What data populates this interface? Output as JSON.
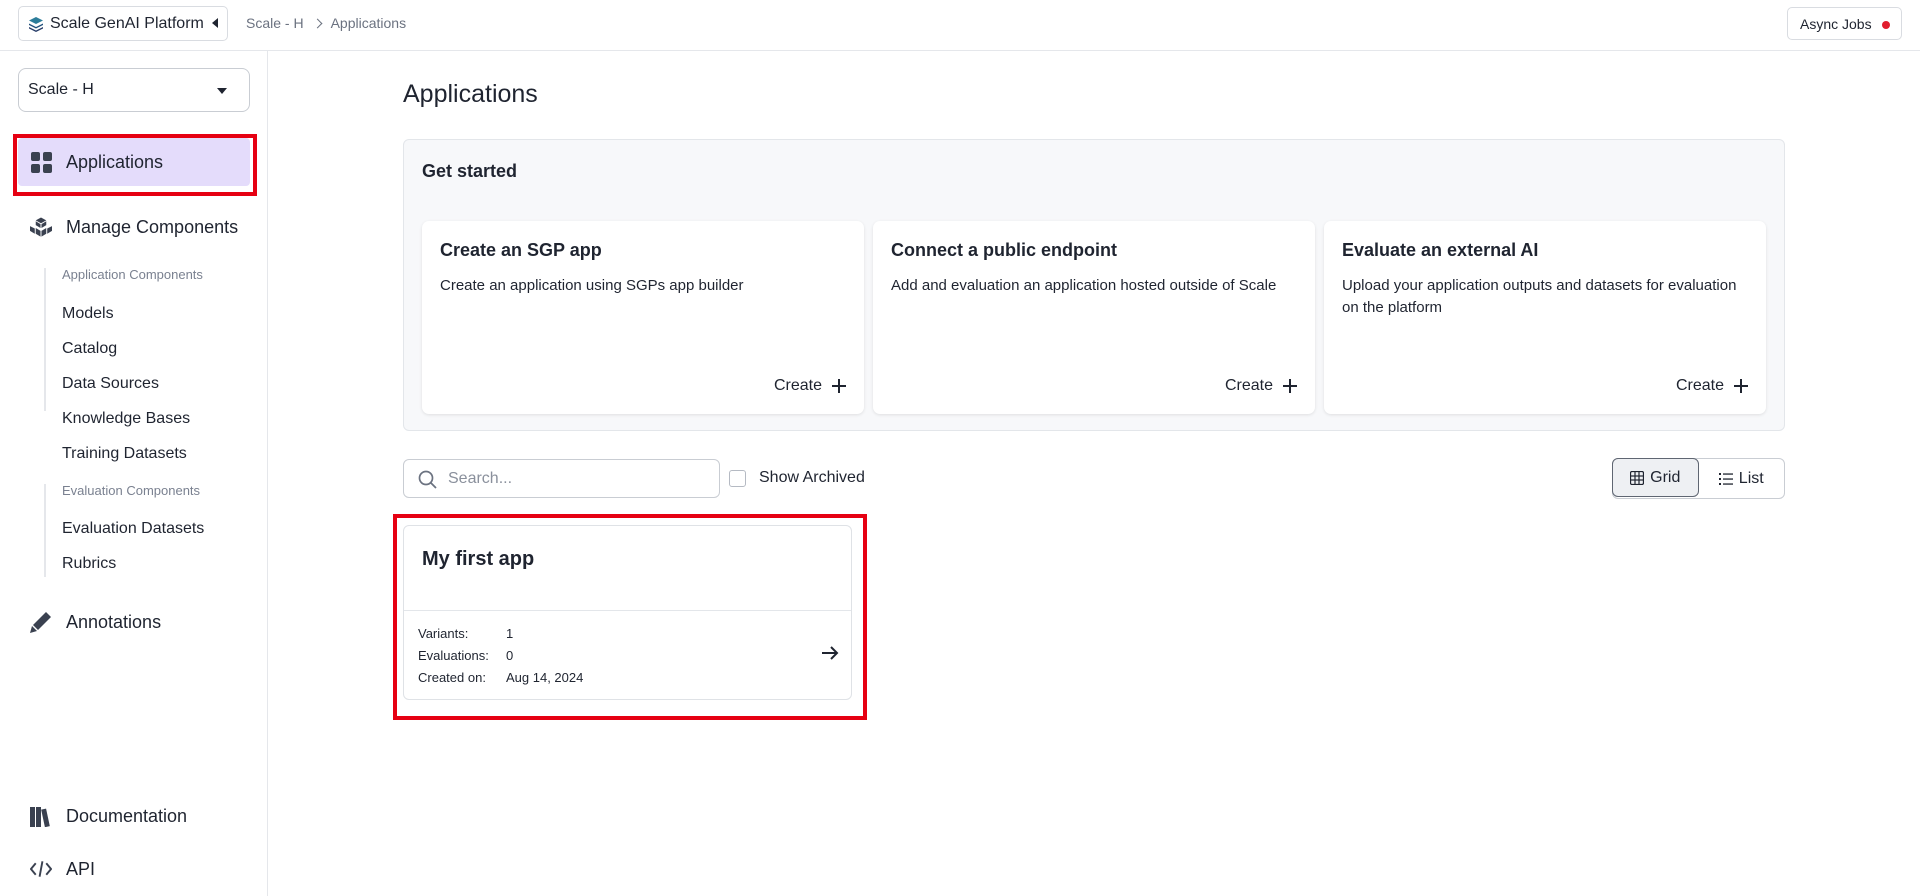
{
  "topbar": {
    "brand": "Scale GenAI Platform",
    "breadcrumb": [
      "Scale - H",
      "Applications"
    ],
    "async_jobs": "Async Jobs"
  },
  "sidebar": {
    "account": "Scale - H",
    "applications": "Applications",
    "manage_components": "Manage Components",
    "app_components_heading": "Application Components",
    "app_components": [
      "Models",
      "Catalog",
      "Data Sources",
      "Knowledge Bases",
      "Training Datasets"
    ],
    "eval_components_heading": "Evaluation Components",
    "eval_components": [
      "Evaluation Datasets",
      "Rubrics"
    ],
    "annotations": "Annotations",
    "documentation": "Documentation",
    "api": "API"
  },
  "main": {
    "title": "Applications",
    "get_started": {
      "title": "Get started",
      "cards": [
        {
          "title": "Create an SGP app",
          "desc": "Create an application using SGPs app builder",
          "action": "Create"
        },
        {
          "title": "Connect a public endpoint",
          "desc": "Add and evaluation an application hosted outside of Scale",
          "action": "Create"
        },
        {
          "title": "Evaluate an external AI",
          "desc": "Upload your application outputs and datasets for evaluation on the platform",
          "action": "Create"
        }
      ]
    },
    "search_placeholder": "Search...",
    "show_archived": "Show Archived",
    "view_grid": "Grid",
    "view_list": "List",
    "apps": [
      {
        "name": "My first app",
        "variants_label": "Variants:",
        "variants": "1",
        "evaluations_label": "Evaluations:",
        "evaluations": "0",
        "created_label": "Created on:",
        "created": "Aug 14, 2024"
      }
    ]
  },
  "colors": {
    "active_nav_bg": "#e4dcfb",
    "highlight": "#e60012",
    "async_dot": "#e11d2e"
  }
}
